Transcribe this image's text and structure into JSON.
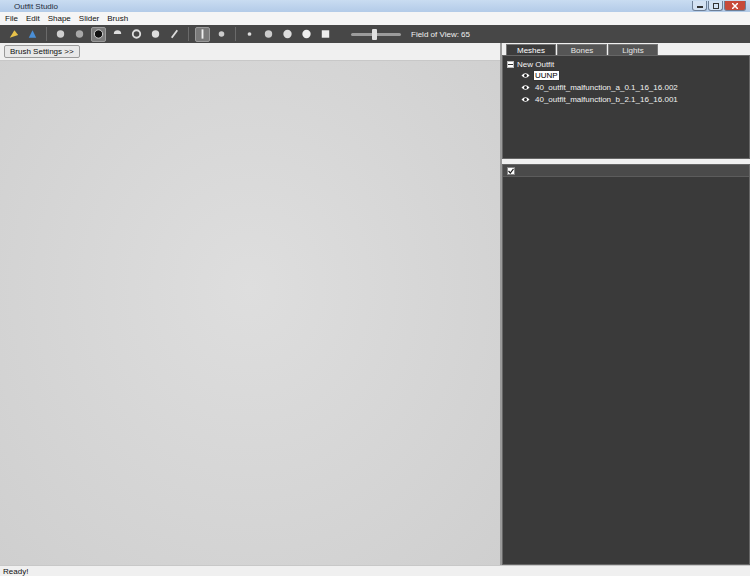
{
  "window": {
    "title": "Outfit Studio"
  },
  "menu": [
    "File",
    "Edit",
    "Shape",
    "Slider",
    "Brush"
  ],
  "toolbar": {
    "tools": [
      {
        "selected": false
      },
      {
        "selected": false
      },
      {
        "selected": false
      },
      {
        "selected": false
      },
      {
        "selected": true
      },
      {
        "selected": false
      },
      {
        "selected": false
      },
      {
        "selected": false
      },
      {
        "selected": false
      },
      {
        "selected": true
      },
      {
        "selected": false
      },
      {
        "selected": false
      },
      {
        "selected": false
      },
      {
        "selected": false
      },
      {
        "selected": false
      },
      {
        "selected": false
      }
    ],
    "field_of_view": {
      "label": "Field of View: 65",
      "level": 0.45
    }
  },
  "brush_settings": {
    "label": "Brush Settings >>"
  },
  "tabs": [
    {
      "label": "Meshes",
      "selected": true
    },
    {
      "label": "Bones",
      "selected": false
    },
    {
      "label": "Lights",
      "selected": false
    }
  ],
  "tree": {
    "root": {
      "label": "New Outfit",
      "expanded": true
    },
    "items": [
      {
        "label": "UUNP",
        "visible": true,
        "selected": true
      },
      {
        "label": "40_outfit_malfunction_a_0.1_16_16.002",
        "visible": true,
        "selected": false
      },
      {
        "label": "40_outfit_malfunction_b_2.1_16_16.001",
        "visible": true,
        "selected": false
      }
    ]
  },
  "properties": {
    "checked": true
  },
  "status_bar": "Ready!"
}
